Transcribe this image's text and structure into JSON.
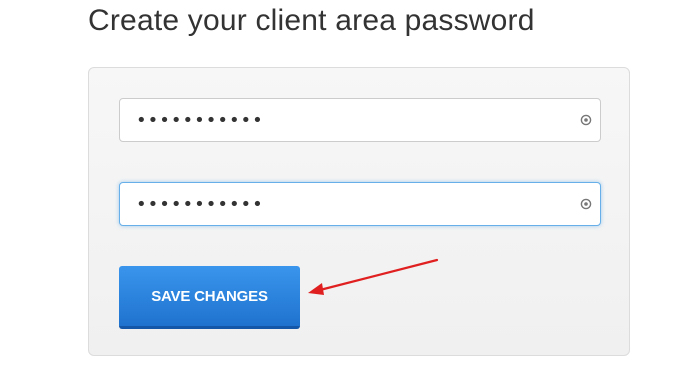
{
  "page": {
    "title": "Create your client area password"
  },
  "form": {
    "password_value": "•••••••••••",
    "confirm_value": "•••••••••••",
    "reveal_icon": "eye-reveal-icon",
    "save_label": "SAVE CHANGES"
  },
  "colors": {
    "button": "#2a84e0",
    "focus_border": "#66afe9",
    "annotation_arrow": "#e02020"
  }
}
